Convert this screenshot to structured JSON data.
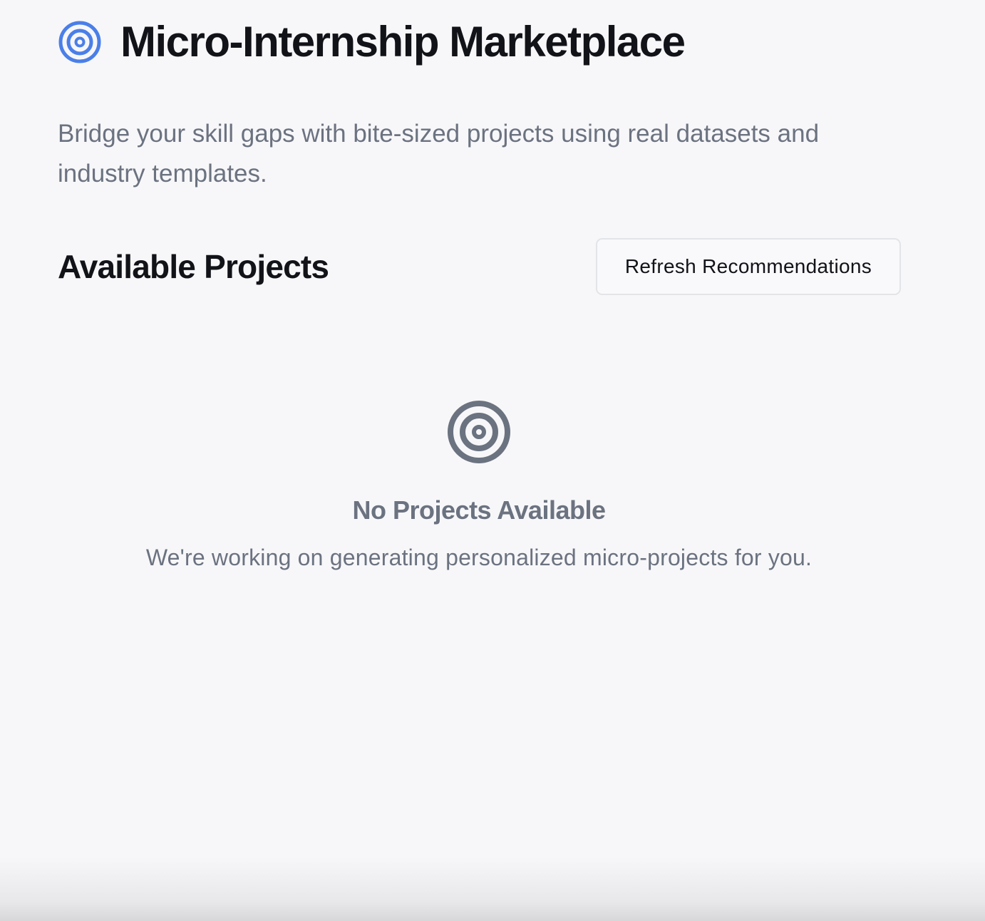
{
  "header": {
    "title": "Micro-Internship Marketplace",
    "icon": "target-icon",
    "icon_color": "#4a7fe8",
    "subtitle": "Bridge your skill gaps with bite-sized projects using real datasets and industry templates."
  },
  "projects_section": {
    "heading": "Available Projects",
    "refresh_label": "Refresh Recommendations"
  },
  "empty_state": {
    "icon": "target-icon",
    "icon_color": "#6b7280",
    "title": "No Projects Available",
    "description": "We're working on generating personalized micro-projects for you."
  }
}
